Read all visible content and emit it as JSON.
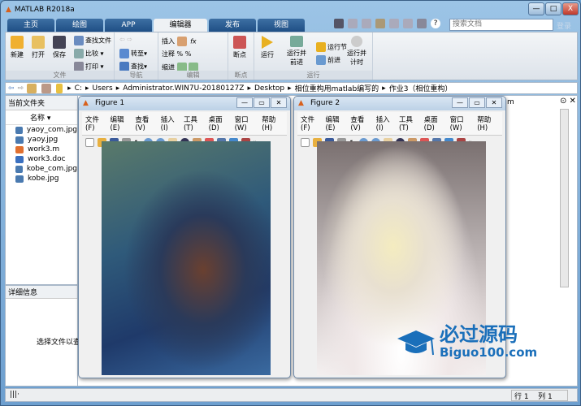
{
  "window": {
    "title": "MATLAB R2018a",
    "controls": [
      "—",
      "□",
      "X"
    ]
  },
  "tabs": [
    {
      "label": "主页"
    },
    {
      "label": "绘图"
    },
    {
      "label": "APP"
    },
    {
      "label": "编辑器",
      "active": true
    },
    {
      "label": "发布"
    },
    {
      "label": "视图"
    }
  ],
  "search": {
    "placeholder": "搜索文档",
    "login": "登录"
  },
  "ribbon": {
    "file": {
      "label": "文件",
      "new": "新建",
      "open": "打开",
      "save": "保存",
      "find_files": "查找文件",
      "compare": "比较",
      "print": "打印"
    },
    "nav": {
      "label": "导航",
      "goto": "转至",
      "find": "查找"
    },
    "edit": {
      "label": "编辑",
      "insert": "插入",
      "comment": "注释",
      "indent": "缩进",
      "fx": "fx"
    },
    "breakpoints": {
      "label": "断点",
      "breakpoints": "断点"
    },
    "run": {
      "label": "运行",
      "run": "运行",
      "run_advance": "运行并\n前进",
      "run_section": "运行节",
      "advance": "前进",
      "run_time": "运行并\n计时"
    }
  },
  "address": {
    "segments": [
      "C:",
      "Users",
      "Administrator.WIN7U-20180127Z",
      "Desktop",
      "相位重构用matlab编写的",
      "作业3（相位重构）"
    ]
  },
  "current_folder": {
    "title": "当前文件夹",
    "column": "名称",
    "files": [
      {
        "name": "yaoy_com.jpg",
        "type": "image"
      },
      {
        "name": "yaoy.jpg",
        "type": "image"
      },
      {
        "name": "work3.m",
        "type": "script"
      },
      {
        "name": "work3.doc",
        "type": "doc"
      },
      {
        "name": "kobe_com.jpg",
        "type": "image"
      },
      {
        "name": "kobe.jpg",
        "type": "image"
      }
    ]
  },
  "details": {
    "title": "详细信息",
    "message": "选择文件以查看详细信息"
  },
  "editor": {
    "tab_fragment": "m"
  },
  "figures": [
    {
      "title": "Figure 1",
      "menu": [
        "文件(F)",
        "编辑(E)",
        "查看(V)",
        "插入(I)",
        "工具(T)",
        "桌面(D)",
        "窗口(W)",
        "帮助(H)"
      ]
    },
    {
      "title": "Figure 2",
      "menu": [
        "文件(F)",
        "编辑(E)",
        "查看(V)",
        "插入(I)",
        "工具(T)",
        "桌面(D)",
        "窗口(W)",
        "帮助(H)"
      ]
    }
  ],
  "status": {
    "row_label": "行",
    "row": "1",
    "col_label": "列",
    "col": "1"
  },
  "watermark": {
    "cn": "必过源码",
    "en": "Biguo100.com",
    "color": "#1a6fba"
  }
}
